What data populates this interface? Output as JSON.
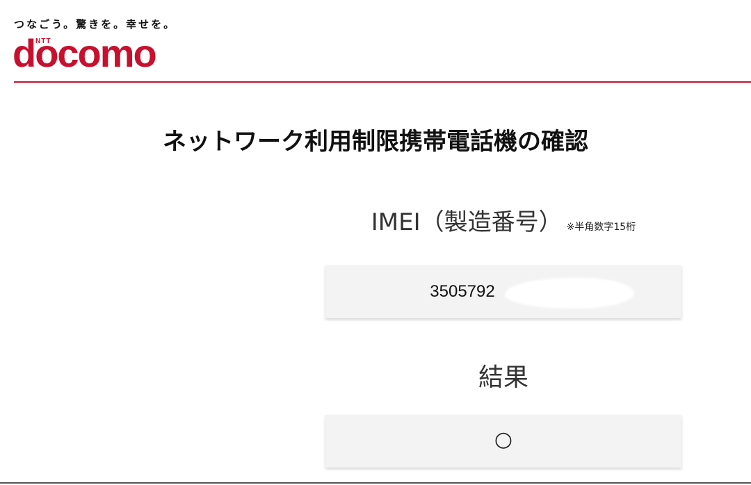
{
  "header": {
    "tagline": "つなごう。驚きを。幸せを。",
    "logo_small": "NTT",
    "logo_word": "docomo",
    "brand_color": "#c8102e"
  },
  "main": {
    "title": "ネットワーク利用制限携帯電話機の確認",
    "imei": {
      "label": "IMEI（製造番号）",
      "note": "※半角数字15桁",
      "value": "3505792"
    },
    "result": {
      "label": "結果",
      "value": "○"
    }
  }
}
